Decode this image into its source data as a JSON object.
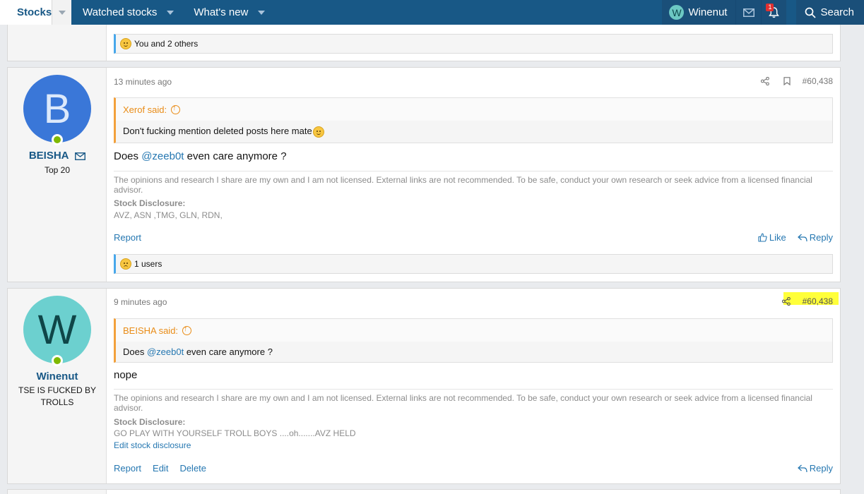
{
  "nav": {
    "active_tab": "Stocks",
    "items": [
      "Watched stocks",
      "What's new"
    ],
    "user": {
      "name": "Winenut",
      "initial": "W"
    },
    "alert_count": "1",
    "search_label": "Search"
  },
  "prev_post": {
    "reaction_text": "You and 2 others"
  },
  "post1": {
    "avatar_initial": "B",
    "avatar_color": "#3a77d8",
    "username": "BEISHA",
    "user_title": "Top 20",
    "time": "13 minutes ago",
    "post_number": "#60,438",
    "quote": {
      "author": "Xerof said:",
      "text": "Don't fucking mention deleted posts here mate"
    },
    "message_before": "Does ",
    "message_mention": "@zeeb0t",
    "message_after": " even care anymore ?",
    "signature": "The opinions and research I share are my own and I am not licensed. External links are not recommended. To be safe, conduct your own research or seek advice from a licensed financial advisor.",
    "disclosure_heading": "Stock Disclosure:",
    "disclosure_value": "AVZ, ASN ,TMG, GLN, RDN,",
    "report_label": "Report",
    "like_label": "Like",
    "reply_label": "Reply",
    "reaction_text": "1 users"
  },
  "post2": {
    "avatar_initial": "W",
    "avatar_color": "#6cd0cf",
    "username": "Winenut",
    "user_title": "TSE IS FUCKED BY TROLLS",
    "time": "9 minutes ago",
    "post_number": "#60,438",
    "quote": {
      "author": "BEISHA said:",
      "text_before": "Does ",
      "text_mention": "@zeeb0t",
      "text_after": " even care anymore ?"
    },
    "message": "nope",
    "signature": "The opinions and research I share are my own and I am not licensed. External links are not recommended. To be safe, conduct your own research or seek advice from a licensed financial advisor.",
    "disclosure_heading": "Stock Disclosure:",
    "disclosure_value": "GO PLAY WITH YOURSELF TROLL BOYS ....oh.......AVZ HELD",
    "edit_disclosure_label": "Edit stock disclosure",
    "report_label": "Report",
    "edit_label": "Edit",
    "delete_label": "Delete",
    "reply_label": "Reply"
  }
}
